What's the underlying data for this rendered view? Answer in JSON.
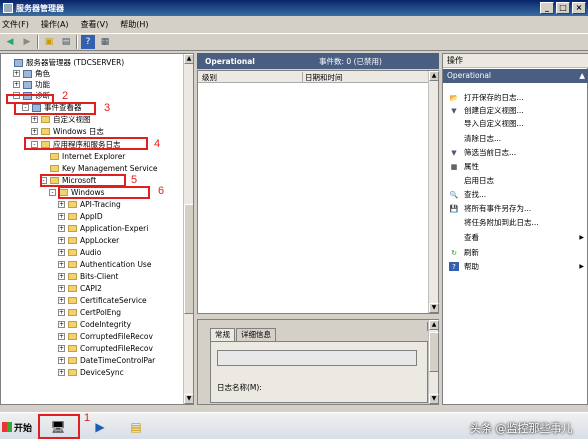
{
  "window": {
    "title": "服务器管理器"
  },
  "menu": [
    "文件(F)",
    "操作(A)",
    "查看(V)",
    "帮助(H)"
  ],
  "tree": {
    "rows": [
      {
        "label": "服务器管理器 (TDCSERVER)",
        "exp": "",
        "indent": 0
      },
      {
        "label": "角色",
        "exp": "+",
        "indent": 1
      },
      {
        "label": "功能",
        "exp": "+",
        "indent": 1
      },
      {
        "label": "诊断",
        "exp": "−",
        "indent": 1
      },
      {
        "label": "事件查看器",
        "exp": "−",
        "indent": 2
      },
      {
        "label": "自定义视图",
        "exp": "+",
        "indent": 3
      },
      {
        "label": "Windows 日志",
        "exp": "+",
        "indent": 3
      },
      {
        "label": "应用程序和服务日志",
        "exp": "−",
        "indent": 3
      },
      {
        "label": "Internet Explorer",
        "exp": "",
        "indent": 4
      },
      {
        "label": "Key Management Service",
        "exp": "",
        "indent": 4
      },
      {
        "label": "Microsoft",
        "exp": "−",
        "indent": 4
      },
      {
        "label": "Windows",
        "exp": "−",
        "indent": 5
      },
      {
        "label": "API-Tracing",
        "exp": "+",
        "indent": 6
      },
      {
        "label": "AppID",
        "exp": "+",
        "indent": 6
      },
      {
        "label": "Application-Experi",
        "exp": "+",
        "indent": 6
      },
      {
        "label": "AppLocker",
        "exp": "+",
        "indent": 6
      },
      {
        "label": "Audio",
        "exp": "+",
        "indent": 6
      },
      {
        "label": "Authentication Use",
        "exp": "+",
        "indent": 6
      },
      {
        "label": "Bits-Client",
        "exp": "+",
        "indent": 6
      },
      {
        "label": "CAPI2",
        "exp": "+",
        "indent": 6
      },
      {
        "label": "CertificateService",
        "exp": "+",
        "indent": 6
      },
      {
        "label": "CertPolEng",
        "exp": "+",
        "indent": 6
      },
      {
        "label": "CodeIntegrity",
        "exp": "+",
        "indent": 6
      },
      {
        "label": "CorruptedFileRecov",
        "exp": "+",
        "indent": 6
      },
      {
        "label": "CorruptedFileRecov",
        "exp": "+",
        "indent": 6
      },
      {
        "label": "DateTimeControlPar",
        "exp": "+",
        "indent": 6
      },
      {
        "label": "DeviceSync",
        "exp": "+",
        "indent": 6
      }
    ]
  },
  "annotations": [
    "1",
    "2",
    "3",
    "4",
    "5",
    "6"
  ],
  "center": {
    "header_title": "Operational",
    "header_count": "事件数: 0 (已禁用)",
    "columns": [
      "级别",
      "日期和时间"
    ],
    "tabs": [
      "常规",
      "详细信息"
    ],
    "log_name_label": "日志名称(M):"
  },
  "actions": {
    "title": "操作",
    "section": "Operational",
    "items": [
      {
        "label": "打开保存的日志...",
        "icon": "open-log-icon",
        "arrow": false
      },
      {
        "label": "创建自定义视图...",
        "icon": "filter-icon",
        "arrow": false
      },
      {
        "label": "导入自定义视图...",
        "icon": "",
        "arrow": false
      },
      {
        "label": "清除日志...",
        "icon": "",
        "arrow": false
      },
      {
        "label": "筛选当前日志...",
        "icon": "filter-icon",
        "arrow": false
      },
      {
        "label": "属性",
        "icon": "properties-icon",
        "arrow": false
      },
      {
        "label": "启用日志",
        "icon": "",
        "arrow": false
      },
      {
        "label": "查找...",
        "icon": "find-icon",
        "arrow": false
      },
      {
        "label": "将所有事件另存为...",
        "icon": "save-icon",
        "arrow": false
      },
      {
        "label": "将任务附加到此日志...",
        "icon": "",
        "arrow": false
      },
      {
        "label": "查看",
        "icon": "",
        "arrow": true
      },
      {
        "label": "刷新",
        "icon": "refresh-icon",
        "arrow": false
      },
      {
        "label": "帮助",
        "icon": "help-icon",
        "arrow": true
      }
    ]
  },
  "taskbar": {
    "start_label": "开始"
  },
  "watermark": "头条 @监控那些事儿",
  "colors": {
    "annotation": "#e02020",
    "header": "#4a5e82"
  }
}
